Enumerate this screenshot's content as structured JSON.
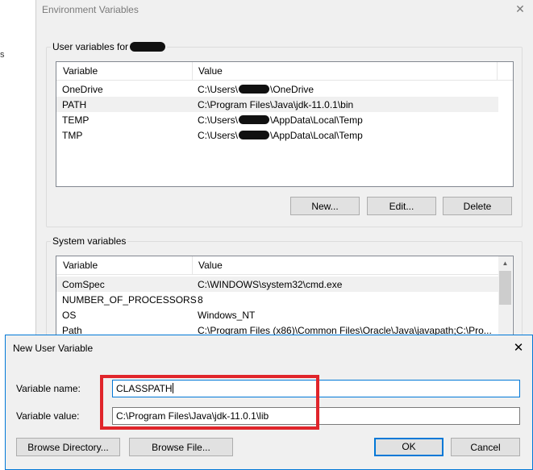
{
  "left_fragment": "s",
  "env_window": {
    "title": "Environment Variables",
    "close_glyph": "✕",
    "user_group": {
      "title_prefix": "User variables for",
      "columns": [
        "Variable",
        "Value"
      ],
      "rows": [
        {
          "variable": "OneDrive",
          "value_pre": "C:\\Users\\",
          "value_post": "\\OneDrive"
        },
        {
          "variable": "PATH",
          "value": "C:\\Program Files\\Java\\jdk-11.0.1\\bin"
        },
        {
          "variable": "TEMP",
          "value_pre": "C:\\Users\\",
          "value_post": "\\AppData\\Local\\Temp"
        },
        {
          "variable": "TMP",
          "value_pre": "C:\\Users\\",
          "value_post": "\\AppData\\Local\\Temp"
        }
      ],
      "buttons": {
        "new": "New...",
        "edit": "Edit...",
        "delete": "Delete"
      }
    },
    "system_group": {
      "title": "System variables",
      "columns": [
        "Variable",
        "Value"
      ],
      "rows": [
        {
          "variable": "ComSpec",
          "value": "C:\\WINDOWS\\system32\\cmd.exe"
        },
        {
          "variable": "NUMBER_OF_PROCESSORS",
          "value": "8"
        },
        {
          "variable": "OS",
          "value": "Windows_NT"
        },
        {
          "variable": "Path",
          "value": "C:\\Program Files (x86)\\Common Files\\Oracle\\Java\\javapath;C:\\Pro..."
        }
      ]
    }
  },
  "dialog": {
    "title": "New User Variable",
    "close_glyph": "✕",
    "name_label": "Variable name:",
    "name_value": "CLASSPATH",
    "value_label": "Variable value:",
    "value_value": "C:\\Program Files\\Java\\jdk-11.0.1\\lib",
    "buttons": {
      "browse_directory": "Browse Directory...",
      "browse_file": "Browse File...",
      "ok": "OK",
      "cancel": "Cancel"
    }
  },
  "colors": {
    "accent": "#0078d7",
    "highlight": "#e0252b",
    "window_bg": "#f0f0f0"
  }
}
